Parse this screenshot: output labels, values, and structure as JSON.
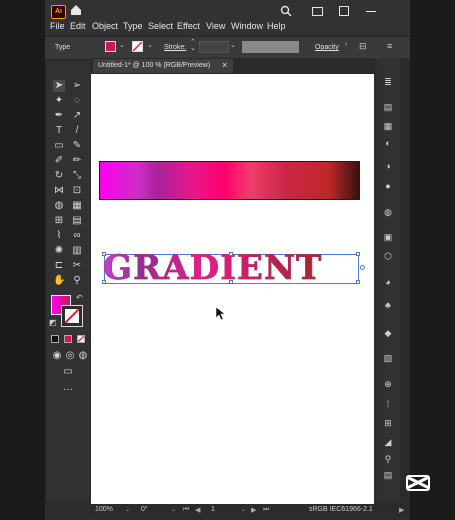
{
  "app": {
    "logo_text": "Ai"
  },
  "menu": {
    "items": [
      "File",
      "Edit",
      "Object",
      "Type",
      "Select",
      "Effect",
      "View",
      "Window",
      "Help"
    ]
  },
  "control_bar": {
    "type_label": "Type",
    "stroke_label": "Stroke:",
    "opacity_label": "Opacity",
    "fill_color": "#d4145a"
  },
  "document": {
    "tab_title": "Untitled-1* @ 100 % (RGB/Preview)",
    "close_glyph": "×"
  },
  "canvas": {
    "word": "GRADIENT"
  },
  "status_bar": {
    "zoom": "100%",
    "rotation": "0°",
    "artboard": "1",
    "profile": "sRGB IEC61966-2.1"
  },
  "colors": {
    "accent": "#4a7bd6",
    "fill_swatch": "#d4145a",
    "gradient_start": "#ff00ee",
    "gradient_end": "#3a1010"
  }
}
